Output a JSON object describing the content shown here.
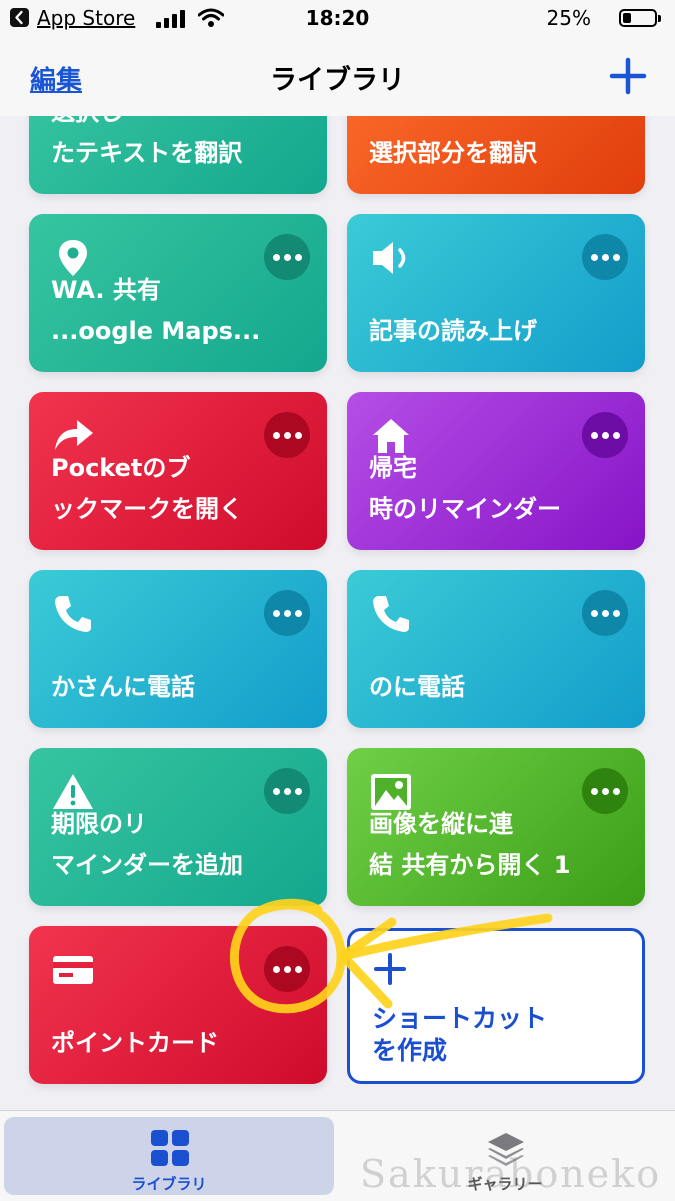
{
  "status_bar": {
    "back_app": "App Store",
    "time": "18:20",
    "battery": "25%"
  },
  "nav": {
    "edit": "編集",
    "title": "ライブラリ"
  },
  "shortcuts": [
    {
      "label": "選択し\nたテキストを翻訳",
      "color": "teal",
      "icon": "none"
    },
    {
      "label": "選択部分を翻訳",
      "color": "orange",
      "icon": "none"
    },
    {
      "label": "WA. 共有\n...oogle Maps...",
      "color": "teal",
      "icon": "map-pin-icon"
    },
    {
      "label": "記事の読み上げ",
      "color": "cyan",
      "icon": "speaker-icon"
    },
    {
      "label": "Pocketのブ\nックマークを開く",
      "color": "red",
      "icon": "share-arrow-icon"
    },
    {
      "label": "帰宅\n時のリマインダー",
      "color": "purple",
      "icon": "home-icon"
    },
    {
      "label": "かさんに電話",
      "color": "cyan",
      "icon": "phone-icon"
    },
    {
      "label": "のに電話",
      "color": "cyan",
      "icon": "phone-icon"
    },
    {
      "label": "期限のリ\nマインダーを追加",
      "color": "teal",
      "icon": "warning-icon"
    },
    {
      "label": "画像を縦に連\n結 共有から開く 1",
      "color": "green",
      "icon": "image-icon"
    },
    {
      "label": "ポイントカード",
      "color": "red",
      "icon": "card-icon"
    }
  ],
  "create_shortcut": "ショートカット\nを作成",
  "tabs": [
    {
      "label": "ライブラリ",
      "active": true
    },
    {
      "label": "ギャラリー",
      "active": false
    }
  ],
  "watermark": "Sakuraboneko",
  "accent_color": "#1a4fd0"
}
